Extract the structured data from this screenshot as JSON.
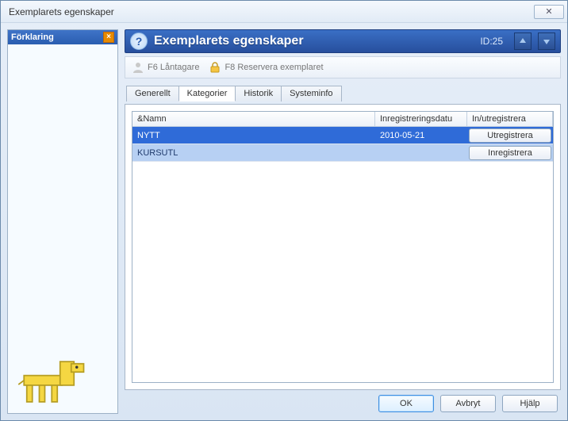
{
  "window": {
    "title": "Exemplarets egenskaper"
  },
  "sidebar": {
    "header": "Förklaring"
  },
  "header": {
    "title": "Exemplarets egenskaper",
    "id_label": "ID:25"
  },
  "toolbar": {
    "borrower": "F6 Låntagare",
    "reserve": "F8 Reservera exemplaret"
  },
  "tabs": {
    "general": "Generellt",
    "categories": "Kategorier",
    "history": "Historik",
    "system": "Systeminfo"
  },
  "grid": {
    "col_name": "&Namn",
    "col_reg": "Inregistreringsdatu",
    "col_action": "In/utregistrera",
    "rows": [
      {
        "name": "NYTT",
        "date": "2010-05-21",
        "action": "Utregistrera"
      },
      {
        "name": "KURSUTL",
        "date": "",
        "action": "Inregistrera"
      }
    ]
  },
  "footer": {
    "ok": "OK",
    "cancel": "Avbryt",
    "help": "Hjälp"
  }
}
